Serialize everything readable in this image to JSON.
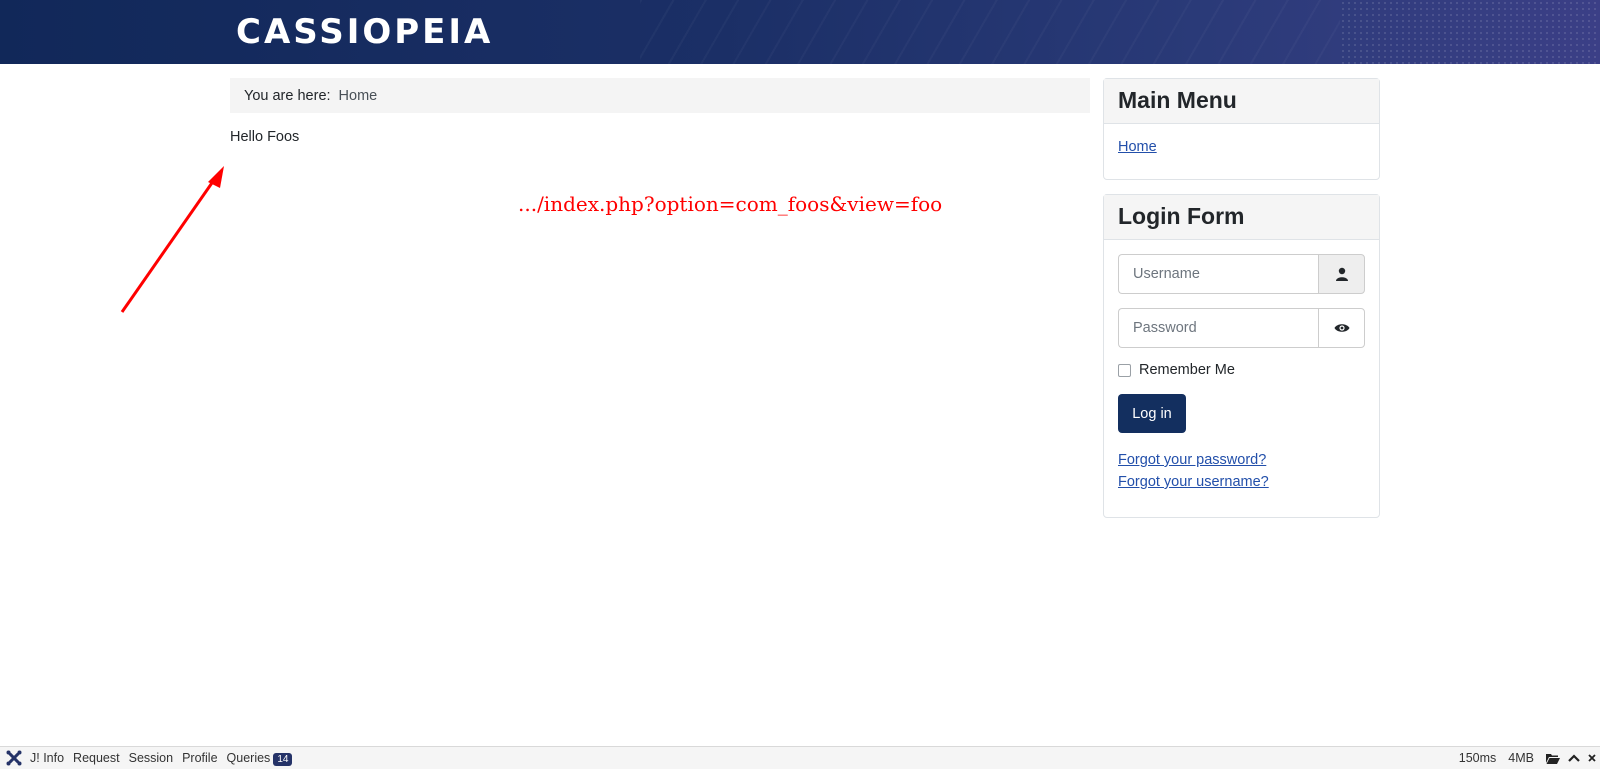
{
  "header": {
    "brand": "CASSIOPEIA"
  },
  "breadcrumb": {
    "label": "You are here:",
    "items": [
      "Home"
    ]
  },
  "content": {
    "text": "Hello Foos"
  },
  "annotation": {
    "url_text": ".../index.php?option=com_foos&view=foo",
    "color": "#ff0000"
  },
  "main_menu": {
    "title": "Main Menu",
    "items": [
      "Home"
    ]
  },
  "login_form": {
    "title": "Login Form",
    "username_placeholder": "Username",
    "password_placeholder": "Password",
    "remember_label": "Remember Me",
    "login_button": "Log in",
    "forgot_password": "Forgot your password?",
    "forgot_username": "Forgot your username?"
  },
  "debugbar": {
    "tabs": [
      "J! Info",
      "Request",
      "Session",
      "Profile",
      "Queries"
    ],
    "queries_count": "14",
    "time": "150ms",
    "memory": "4MB",
    "icons": [
      "joomla-logo-icon",
      "folder-open-icon",
      "chevron-up-icon",
      "close-icon"
    ]
  },
  "colors": {
    "header_start": "#112859",
    "header_end": "#3b3f86",
    "button": "#132f5f",
    "link": "#224faa"
  }
}
